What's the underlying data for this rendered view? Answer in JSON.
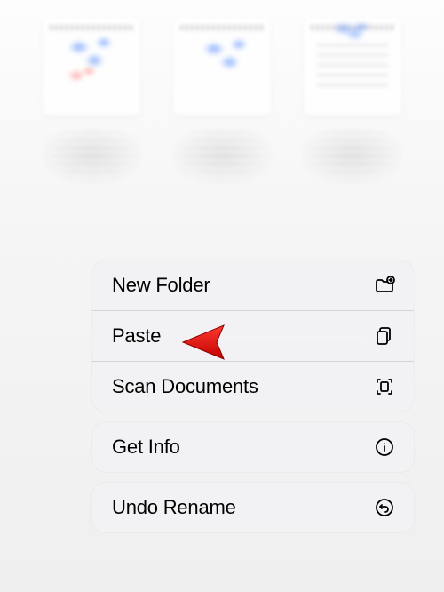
{
  "menu": {
    "groups": [
      {
        "items": [
          {
            "label": "New Folder",
            "icon": "folder-plus-icon"
          },
          {
            "label": "Paste",
            "icon": "clipboard-icon"
          },
          {
            "label": "Scan Documents",
            "icon": "scan-icon"
          }
        ]
      },
      {
        "items": [
          {
            "label": "Get Info",
            "icon": "info-icon"
          }
        ]
      },
      {
        "items": [
          {
            "label": "Undo Rename",
            "icon": "undo-icon"
          }
        ]
      }
    ]
  },
  "annotation": {
    "arrow_target": "paste-menu-item",
    "arrow_color": "#ff1a1a"
  }
}
